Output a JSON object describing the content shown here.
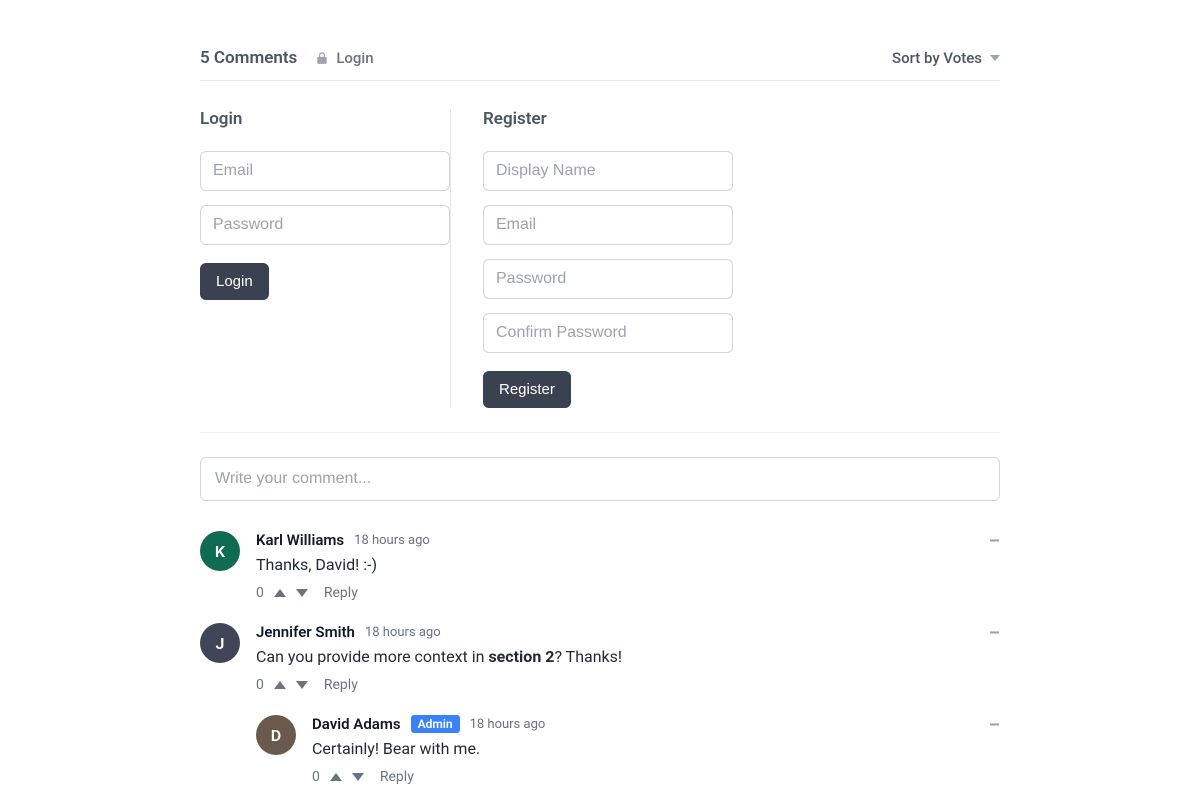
{
  "header": {
    "count_label": "5 Comments",
    "login_link": "Login",
    "sort_label": "Sort by Votes"
  },
  "auth": {
    "login": {
      "title": "Login",
      "email_placeholder": "Email",
      "password_placeholder": "Password",
      "button": "Login"
    },
    "register": {
      "title": "Register",
      "display_name_placeholder": "Display Name",
      "email_placeholder": "Email",
      "password_placeholder": "Password",
      "confirm_placeholder": "Confirm Password",
      "button": "Register"
    }
  },
  "compose": {
    "placeholder": "Write your comment..."
  },
  "comments": [
    {
      "initial": "K",
      "avatar_color": "#0f6b52",
      "author": "Karl Williams",
      "badge": "",
      "time": "18 hours ago",
      "text": "Thanks, David! :-)",
      "votes": "0"
    },
    {
      "initial": "J",
      "avatar_color": "#3e4657",
      "author": "Jennifer Smith",
      "badge": "",
      "time": "18 hours ago",
      "text_before": "Can you provide more context in ",
      "text_bold": "section 2",
      "text_after": "? Thanks!",
      "votes": "0"
    },
    {
      "initial": "D",
      "avatar_color": "#6b5a4b",
      "author": "David Adams",
      "badge": "Admin",
      "time": "18 hours ago",
      "text": "Certainly! Bear with me.",
      "votes": "0"
    }
  ],
  "labels": {
    "reply": "Reply"
  }
}
